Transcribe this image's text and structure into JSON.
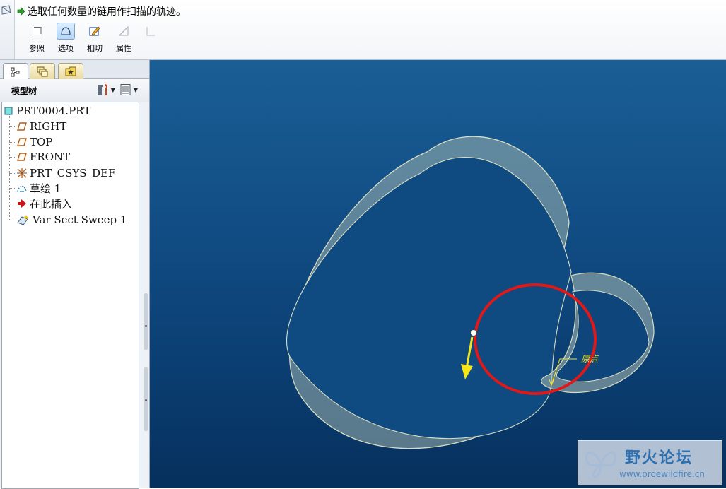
{
  "dashboard": {
    "prompt": "选取任何数量的链用作扫描的轨迹。",
    "tools": [
      {
        "label": "参照",
        "icon": "reference-icon"
      },
      {
        "label": "选项",
        "icon": "options-icon"
      },
      {
        "label": "相切",
        "icon": "tangency-icon"
      },
      {
        "label": "属性",
        "icon": "properties-icon"
      }
    ],
    "active_tool": "选项"
  },
  "model_tree": {
    "title": "模型树",
    "tabs": [
      "model-tree-tab",
      "layers-tab",
      "favorites-tab"
    ],
    "items": [
      {
        "label": "PRT0004.PRT",
        "icon": "part-icon"
      },
      {
        "label": "RIGHT",
        "icon": "datum-plane-icon"
      },
      {
        "label": "TOP",
        "icon": "datum-plane-icon"
      },
      {
        "label": "FRONT",
        "icon": "datum-plane-icon"
      },
      {
        "label": "PRT_CSYS_DEF",
        "icon": "csys-icon"
      },
      {
        "label": "草绘 1",
        "icon": "sketch-icon"
      },
      {
        "label": "在此插入",
        "icon": "insert-here-arrow-icon"
      },
      {
        "label": "Var Sect Sweep 1",
        "icon": "var-sect-sweep-icon"
      }
    ]
  },
  "viewport": {
    "origin_label": "原点",
    "watermark_title": "野火论坛",
    "watermark_url": "www.proewildfire.cn",
    "colors": {
      "background_top": "#1a5e96",
      "background_bottom": "#06305d",
      "surface_edge": "#d7dcc2",
      "surface_fill": "#9fb3ad",
      "selected_chain": "#e01818",
      "direction_arrow": "#f5e61a"
    }
  }
}
